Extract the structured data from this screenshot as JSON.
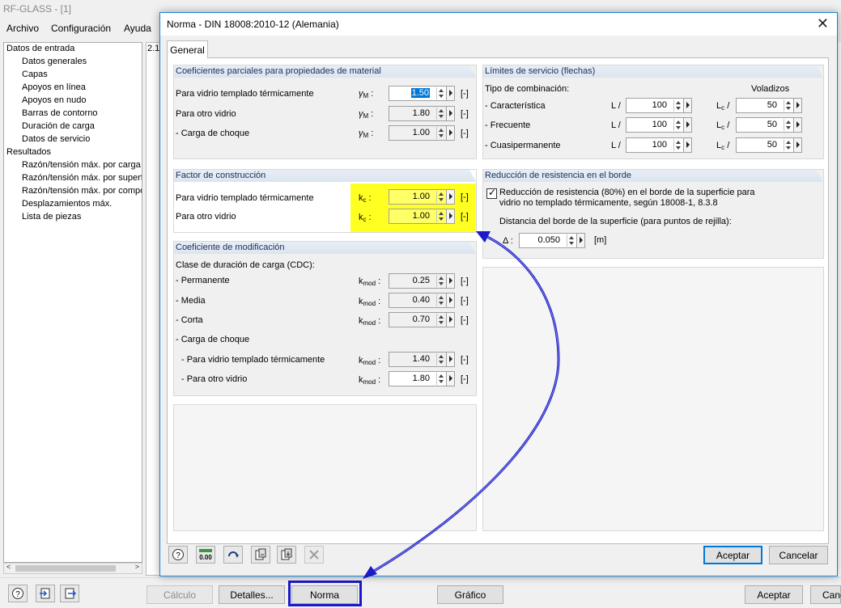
{
  "app": {
    "title": "RF-GLASS - [1]",
    "menu": [
      "Archivo",
      "Configuración",
      "Ayuda"
    ],
    "panel_label": "2.1"
  },
  "tree": {
    "items": [
      {
        "label": "Datos de entrada",
        "level": 0
      },
      {
        "label": "Datos generales",
        "level": 1
      },
      {
        "label": "Capas",
        "level": 1
      },
      {
        "label": "Apoyos en línea",
        "level": 1
      },
      {
        "label": "Apoyos en nudo",
        "level": 1
      },
      {
        "label": "Barras de contorno",
        "level": 1
      },
      {
        "label": "Duración de carga",
        "level": 1
      },
      {
        "label": "Datos de servicio",
        "level": 1
      },
      {
        "label": "Resultados",
        "level": 0
      },
      {
        "label": "Razón/tensión máx. por carga",
        "level": 1
      },
      {
        "label": "Razón/tensión máx. por superf",
        "level": 1
      },
      {
        "label": "Razón/tensión máx. por compo",
        "level": 1
      },
      {
        "label": "Desplazamientos máx.",
        "level": 1
      },
      {
        "label": "Lista de piezas",
        "level": 1
      }
    ]
  },
  "bottombar": {
    "calculo": "Cálculo",
    "detalles": "Detalles...",
    "norma": "Norma",
    "grafico": "Gráfico",
    "aceptar": "Aceptar",
    "cancelar": "Canc"
  },
  "dialog": {
    "title": "Norma - DIN 18008:2010-12 (Alemania)",
    "tab": "General",
    "material": {
      "header": "Coeficientes parciales para propiedades de material",
      "rows": [
        {
          "label": "Para vidrio templado térmicamente",
          "symbol": "γ",
          "sub": "M",
          "value": "1.50",
          "unit": "[-]"
        },
        {
          "label": "Para otro vidrio",
          "symbol": "γ",
          "sub": "M",
          "value": "1.80",
          "unit": "[-]"
        },
        {
          "label": "- Carga de choque",
          "symbol": "γ",
          "sub": "M",
          "value": "1.00",
          "unit": "[-]"
        }
      ]
    },
    "construccion": {
      "header": "Factor de construcción",
      "rows": [
        {
          "label": "Para vidrio templado térmicamente",
          "symbol": "k",
          "sub": "c",
          "value": "1.00",
          "unit": "[-]"
        },
        {
          "label": "Para otro vidrio",
          "symbol": "k",
          "sub": "c",
          "value": "1.00",
          "unit": "[-]"
        }
      ]
    },
    "modificacion": {
      "header": "Coeficiente de modificación",
      "clase": "Clase de duración de carga (CDC):",
      "rows": [
        {
          "label": "- Permanente",
          "symbol": "k",
          "sub": "mod",
          "value": "0.25",
          "unit": "[-]"
        },
        {
          "label": "- Media",
          "symbol": "k",
          "sub": "mod",
          "value": "0.40",
          "unit": "[-]"
        },
        {
          "label": "- Corta",
          "symbol": "k",
          "sub": "mod",
          "value": "0.70",
          "unit": "[-]"
        }
      ],
      "choque": "- Carga de choque",
      "choque_rows": [
        {
          "label": "- Para vidrio templado térmicamente",
          "symbol": "k",
          "sub": "mod",
          "value": "1.40",
          "unit": "[-]"
        },
        {
          "label": "- Para otro vidrio",
          "symbol": "k",
          "sub": "mod",
          "value": "1.80",
          "unit": "[-]"
        }
      ]
    },
    "servicio": {
      "header": "Límites de servicio (flechas)",
      "tipo": "Tipo de combinación:",
      "voladizos": "Voladizos",
      "rows": [
        {
          "label": "- Característica",
          "l_label": "L /",
          "l_value": "100",
          "lc_label": "L",
          "lc_sub": "c",
          "lc_slash": "/",
          "lc_value": "50"
        },
        {
          "label": "- Frecuente",
          "l_label": "L /",
          "l_value": "100",
          "lc_label": "L",
          "lc_sub": "c",
          "lc_slash": "/",
          "lc_value": "50"
        },
        {
          "label": "- Cuasipermanente",
          "l_label": "L /",
          "l_value": "100",
          "lc_label": "L",
          "lc_sub": "c",
          "lc_slash": "/",
          "lc_value": "50"
        }
      ]
    },
    "borde": {
      "header": "Reducción de resistencia en el borde",
      "check_line1": "Reducción de resistencia (80%) en el borde de la superficie para",
      "check_line2": "vidrio no templado térmicamente, según 18008-1, 8.3.8",
      "distancia": "Distancia del borde de la superficie (para puntos de rejilla):",
      "delta": "Δ :",
      "delta_value": "0.050",
      "delta_unit": "[m]"
    },
    "aceptar": "Aceptar",
    "cancelar": "Cancelar",
    "annotation_color": "#1a1ac8",
    "highlight_color": "#ffff22"
  }
}
